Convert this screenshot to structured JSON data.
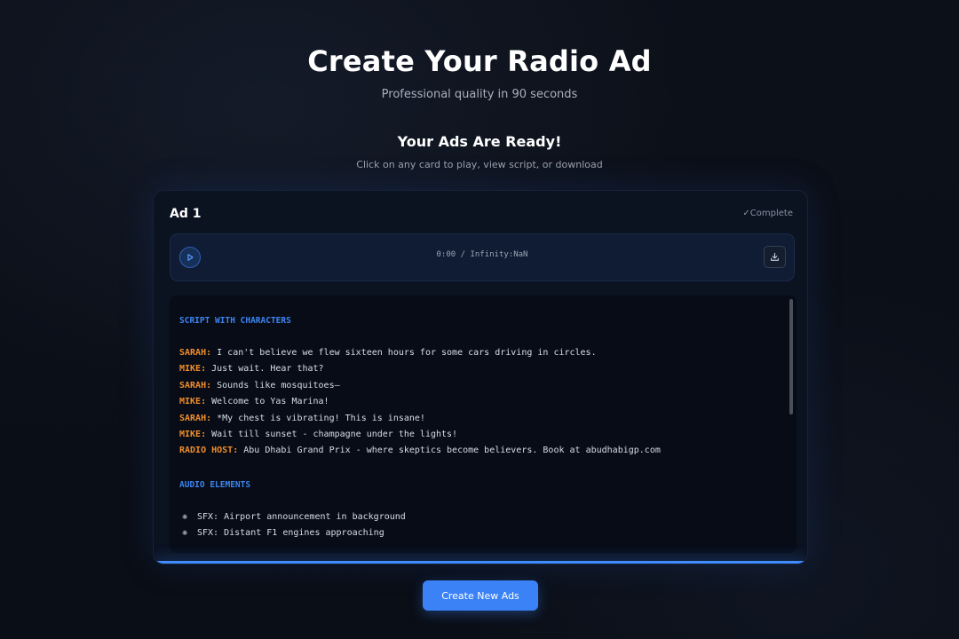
{
  "header": {
    "title": "Create Your Radio Ad",
    "subtitle": "Professional quality in 90 seconds"
  },
  "results": {
    "title": "Your Ads Are Ready!",
    "subtitle": "Click on any card to play, view script, or download"
  },
  "ad_card": {
    "title": "Ad 1",
    "status": "✓Complete",
    "player": {
      "time_display": "0:00 / Infinity:NaN",
      "play_icon": "play-icon",
      "download_icon": "download-icon"
    },
    "script": {
      "heading": "SCRIPT WITH CHARACTERS",
      "lines": [
        {
          "speaker": "SARAH:",
          "text": " I can't believe we flew sixteen hours for some cars driving in circles."
        },
        {
          "speaker": "MIKE:",
          "text": " Just wait. Hear that?"
        },
        {
          "speaker": "SARAH:",
          "text": " Sounds like mosquitoes—"
        },
        {
          "speaker": "MIKE:",
          "text": " Welcome to Yas Marina!"
        },
        {
          "speaker": "SARAH:",
          "text": " *My chest is vibrating! This is insane!"
        },
        {
          "speaker": "MIKE:",
          "text": " Wait till sunset - champagne under the lights!"
        },
        {
          "speaker": "RADIO HOST:",
          "text": " Abu Dhabi Grand Prix - where skeptics become believers. Book at abudhabigp.com"
        }
      ],
      "audio_heading": "AUDIO ELEMENTS",
      "audio_items": [
        {
          "icon": "sound-icon",
          "text": "SFX: Airport announcement in background"
        },
        {
          "icon": "sound-icon",
          "text": "SFX: Distant F1 engines approaching"
        }
      ]
    }
  },
  "cta": {
    "label": "Create New Ads"
  },
  "colors": {
    "accent": "#3b82f6",
    "speaker": "#ef8d2b",
    "section_heading": "#3d84f0",
    "background": "#0b0f18"
  }
}
